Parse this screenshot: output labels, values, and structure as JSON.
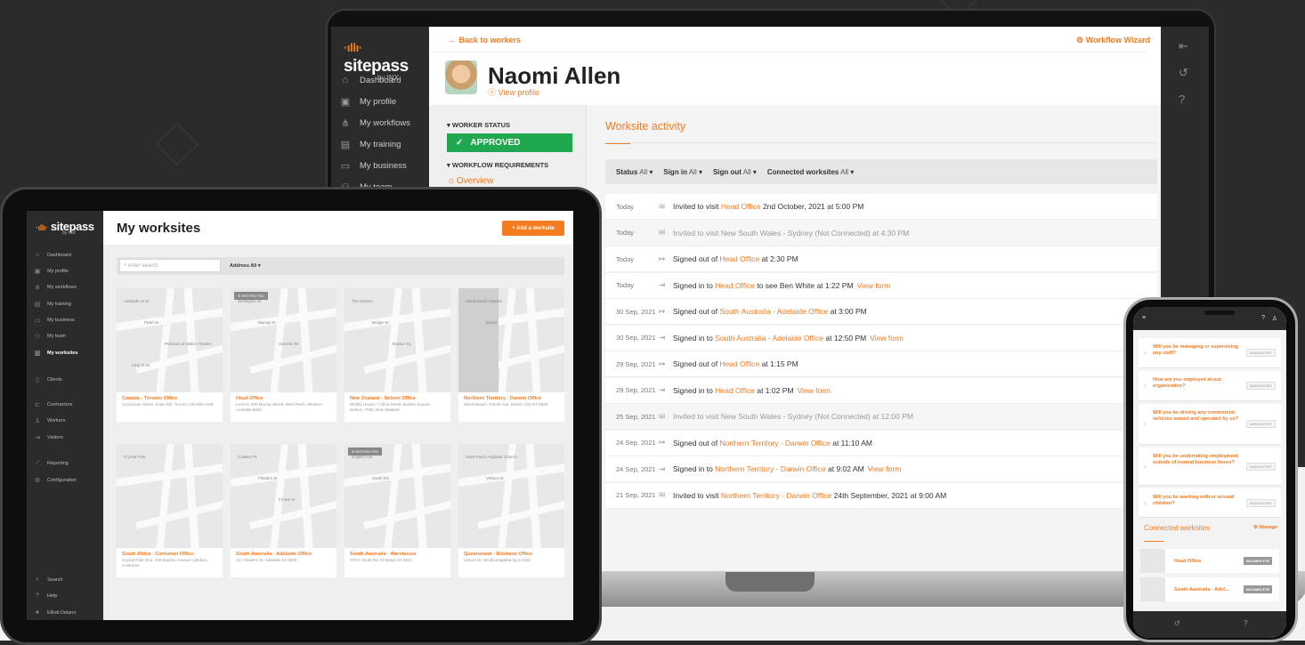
{
  "laptop": {
    "logo": "sitepass",
    "logo_sub": "by INX",
    "nav": [
      {
        "icon": "home-icon",
        "label": "Dashboard"
      },
      {
        "icon": "profile-icon",
        "label": "My profile"
      },
      {
        "icon": "workflow-icon",
        "label": "My workflows"
      },
      {
        "icon": "training-icon",
        "label": "My training"
      },
      {
        "icon": "briefcase-icon",
        "label": "My business"
      },
      {
        "icon": "team-icon",
        "label": "My team"
      }
    ],
    "back_label": "Back to workers",
    "wizard_label": "Workflow Wizard",
    "worker_name": "Naomi Allen",
    "view_profile": "View profile",
    "worker_status_heading": "WORKER STATUS",
    "status": "APPROVED",
    "workflow_heading": "WORKFLOW REQUIREMENTS",
    "overview": "Overview",
    "activity_title": "Worksite activity",
    "filters": [
      {
        "label": "Status",
        "value": "All"
      },
      {
        "label": "Sign in",
        "value": "All"
      },
      {
        "label": "Sign out",
        "value": "All"
      },
      {
        "label": "Connected worksites",
        "value": "All"
      }
    ],
    "activities": [
      {
        "date": "Today",
        "icon": "mail-icon",
        "pre": "Invited to visit ",
        "link": "Head Office",
        "post": " 2nd October, 2021 at 5:00 PM",
        "form": "",
        "muted": false
      },
      {
        "date": "Today",
        "icon": "mail-icon",
        "pre": "Invited to visit ",
        "link": "New South Wales - Sydney (Not Connected)",
        "post": " at 4:30 PM",
        "form": "",
        "muted": true
      },
      {
        "date": "Today",
        "icon": "signout-icon",
        "pre": "Signed out of ",
        "link": "Head Office",
        "post": " at 2:30 PM",
        "form": "",
        "muted": false
      },
      {
        "date": "Today",
        "icon": "signin-icon",
        "pre": "Signed in to ",
        "link": "Head Office",
        "post": " to see Ben White at 1:22 PM",
        "form": "View form",
        "muted": false
      },
      {
        "date": "30 Sep, 2021",
        "icon": "signout-icon",
        "pre": "Signed out of ",
        "link": "South Australia - Adelaide Office",
        "post": " at 3:00 PM",
        "form": "",
        "muted": false
      },
      {
        "date": "30 Sep, 2021",
        "icon": "signin-icon",
        "pre": "Signed in to ",
        "link": "South Australia - Adelaide Office",
        "post": " at 12:50 PM",
        "form": "View form",
        "muted": false
      },
      {
        "date": "29 Sep, 2021",
        "icon": "signout-icon",
        "pre": "Signed out of ",
        "link": "Head Office",
        "post": " at 1:15 PM",
        "form": "",
        "muted": false
      },
      {
        "date": "29 Sep, 2021",
        "icon": "signin-icon",
        "pre": "Signed in to ",
        "link": "Head Office",
        "post": " at 1:02 PM",
        "form": "View form",
        "muted": false
      },
      {
        "date": "25 Sep, 2021",
        "icon": "mail-icon",
        "pre": "Invited to visit ",
        "link": "New South Wales - Sydney (Not Connected)",
        "post": " at 12:00 PM",
        "form": "",
        "muted": true
      },
      {
        "date": "24 Sep, 2021",
        "icon": "signout-icon",
        "pre": "Signed out of ",
        "link": "Northern Territory - Darwin Office",
        "post": " at 11:10 AM",
        "form": "",
        "muted": false
      },
      {
        "date": "24 Sep, 2021",
        "icon": "signin-icon",
        "pre": "Signed in to ",
        "link": "Northern Territory - Darwin Office",
        "post": " at 9:02 AM",
        "form": "View form",
        "muted": false
      },
      {
        "date": "21 Sep, 2021",
        "icon": "mail-icon",
        "pre": "Invited to visit ",
        "link": "Northern Territory - Darwin Office",
        "post": " 24th September, 2021 at 9:00 AM",
        "form": "",
        "muted": false
      }
    ]
  },
  "tablet": {
    "logo": "sitepass",
    "logo_sub": "by INX",
    "nav": [
      {
        "icon": "home-icon",
        "label": "Dashboard"
      },
      {
        "icon": "profile-icon",
        "label": "My profile"
      },
      {
        "icon": "workflow-icon",
        "label": "My workflows"
      },
      {
        "icon": "training-icon",
        "label": "My training"
      },
      {
        "icon": "briefcase-icon",
        "label": "My business"
      },
      {
        "icon": "team-icon",
        "label": "My team"
      },
      {
        "icon": "map-icon",
        "label": "My worksites"
      },
      {
        "icon": "clients-icon",
        "label": "Clients"
      },
      {
        "icon": "contractors-icon",
        "label": "Contractors"
      },
      {
        "icon": "workers-icon",
        "label": "Workers"
      },
      {
        "icon": "visitors-icon",
        "label": "Visitors"
      },
      {
        "icon": "reporting-icon",
        "label": "Reporting"
      },
      {
        "icon": "gear-icon",
        "label": "Configuration"
      },
      {
        "icon": "search-icon",
        "label": "Search"
      },
      {
        "icon": "help-icon",
        "label": "Help"
      },
      {
        "icon": "avatar-icon",
        "label": "Elliott Delano"
      }
    ],
    "title": "My worksites",
    "add_button": "+ Add a worksite",
    "search_placeholder": "enter search",
    "address_filter": "Address  All",
    "restricted": "RESTRICTED",
    "cards": [
      {
        "name": "Canada - Toronto Office",
        "addr": "14 Duncan Street, Suite 200, Toronto ON M5H 3G8",
        "restricted": false,
        "labels": [
          "Adelaide St W",
          "Pearl St",
          "Princess of Wales Theatre",
          "King St W"
        ]
      },
      {
        "name": "Head Office",
        "addr": "Level 4, 600 Murray Street, West Perth, Western Australia 6005",
        "restricted": true,
        "labels": [
          "Wellington St",
          "Murray St",
          "Harvest Ter"
        ]
      },
      {
        "name": "New Zealand - Nelson Office",
        "addr": "Whitby House, 7 Alma Street, Buxton Square, Nelson, 7040, New Zealand",
        "restricted": false,
        "labels": [
          "The Kitchen",
          "Bridge St",
          "Buxton Sq"
        ]
      },
      {
        "name": "Northern Territory - Darwin Office",
        "addr": "Mindil Beach, Gilruth Ave, Darwin City NT 0820",
        "restricted": false,
        "labels": [
          "Mindil Beach Market",
          "Beach"
        ]
      },
      {
        "name": "South Africa - Centurion Office",
        "addr": "Crystal Park One, 249 Basden Avenue Lyttelton, Centurion",
        "restricted": false,
        "labels": [
          "Crystal Park"
        ]
      },
      {
        "name": "South Australia - Adelaide Office",
        "addr": "217 Flinders St, Adelaide SA 5000",
        "restricted": false,
        "labels": [
          "Cowlers Pl",
          "Flinders St",
          "Frome St"
        ]
      },
      {
        "name": "South Australia - Warehouse",
        "addr": "7/67A South Rd, St Marys SA 5042",
        "restricted": true,
        "labels": [
          "English Ave",
          "South Rd"
        ]
      },
      {
        "name": "Queensland - Brisbane Office",
        "addr": "Vulture St, Woolloongabba QLD 4102",
        "restricted": false,
        "labels": [
          "Saint Paul's Anglican Church",
          "Vulture St"
        ]
      }
    ]
  },
  "phone": {
    "questions": [
      {
        "text": "Will you be managing or supervising any staff?",
        "tag": "MANDATORY"
      },
      {
        "text": "How are you employed at our organisation?",
        "tag": "MANDATORY"
      },
      {
        "text": "Will you be driving any commercial vehicles owned and operated by us?",
        "tag": "MANDATORY"
      },
      {
        "text": "Will you be undertaking employment outside of normal business hours?",
        "tag": "MANDATORY"
      },
      {
        "text": "Will you be working with or around children?",
        "tag": "MANDATORY"
      }
    ],
    "connected_title": "Connected worksites",
    "manage": "Manage",
    "worksites": [
      {
        "name": "Head Office",
        "status": "INCOMPLETE"
      },
      {
        "name": "South Australia - Adel...",
        "status": "INCOMPLETE"
      }
    ]
  },
  "colors": {
    "accent": "#f47c20",
    "approved": "#1fa84f",
    "sidebar": "#2b2b2b"
  }
}
